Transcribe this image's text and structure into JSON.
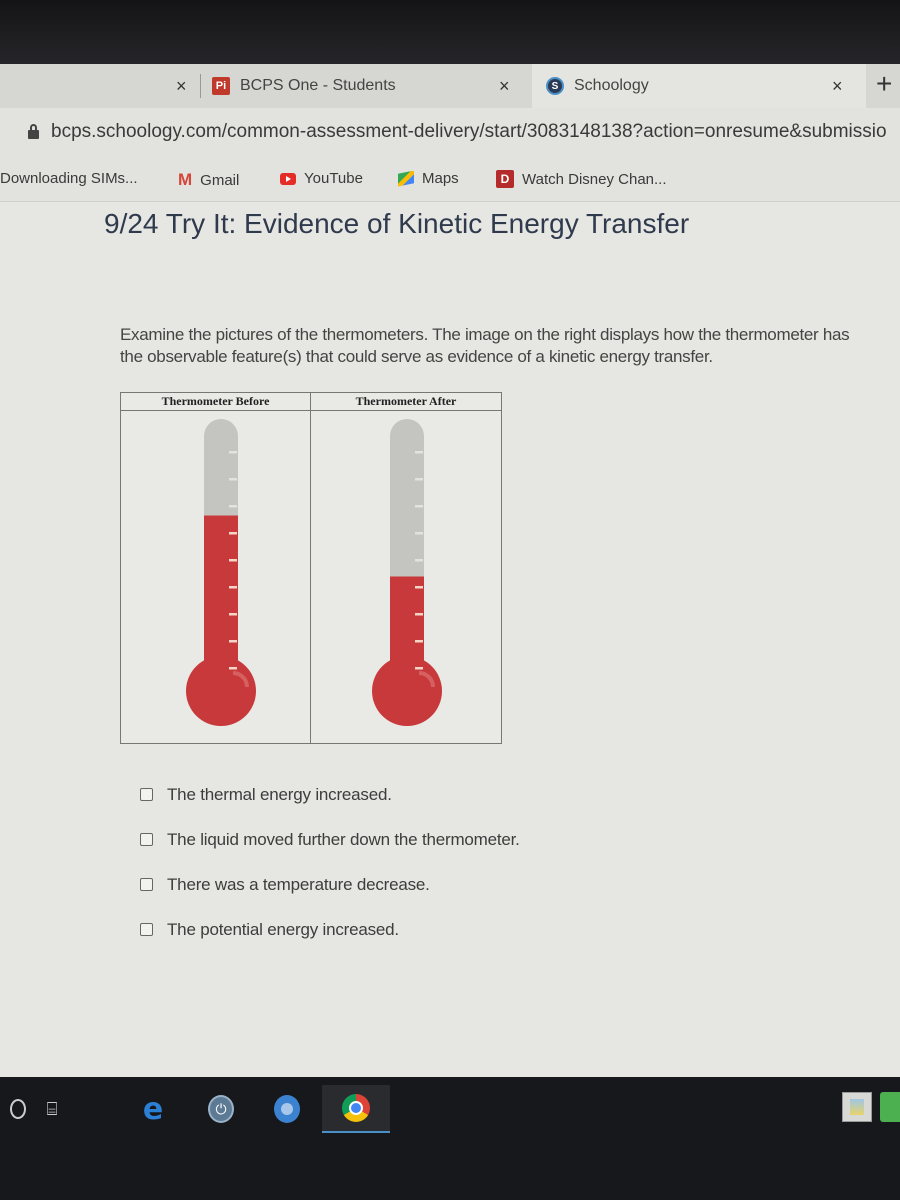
{
  "browser": {
    "tabs": [
      {
        "label": "",
        "close": "×",
        "active": false
      },
      {
        "favicon": "Pi",
        "label": "BCPS One - Students",
        "close": "×",
        "active": false
      },
      {
        "favicon": "S",
        "label": "Schoology",
        "close": "×",
        "active": true
      }
    ],
    "new_tab": "+",
    "url": "bcps.schoology.com/common-assessment-delivery/start/3083148138?action=onresume&submissio",
    "bookmarks": [
      {
        "label": "Downloading SIMs...",
        "icon": "none"
      },
      {
        "label": "Gmail",
        "icon": "gmail-icon",
        "glyph": "M"
      },
      {
        "label": "YouTube",
        "icon": "youtube-icon"
      },
      {
        "label": "Maps",
        "icon": "maps-icon"
      },
      {
        "label": "Watch Disney Chan...",
        "icon": "disney-icon",
        "glyph": "D"
      }
    ]
  },
  "page": {
    "title": "9/24 Try It: Evidence of Kinetic Energy Transfer",
    "prompt_line1": "Examine the pictures of the thermometers. The image on the right displays how the thermometer has",
    "prompt_line2": "the observable feature(s) that could serve as evidence of a kinetic energy transfer.",
    "figure": {
      "before_label": "Thermometer Before",
      "after_label": "Thermometer After",
      "before_fill_fraction": 0.62,
      "after_fill_fraction": 0.38,
      "liquid_color": "#c8393b",
      "tube_color": "#c4c4c0",
      "tick_color": "#f3d6c8"
    },
    "options": [
      {
        "label": "The thermal energy increased.",
        "checked": false
      },
      {
        "label": "The liquid moved further down the thermometer.",
        "checked": false
      },
      {
        "label": "There was a temperature decrease.",
        "checked": false
      },
      {
        "label": "The potential energy increased.",
        "checked": false
      }
    ]
  },
  "taskbar": {
    "items": [
      "cortana",
      "task-view",
      "edge",
      "power-app",
      "chromium",
      "chrome"
    ],
    "power_glyph": "⏻",
    "taskview_glyph": "⌸",
    "edge_glyph": "e"
  }
}
